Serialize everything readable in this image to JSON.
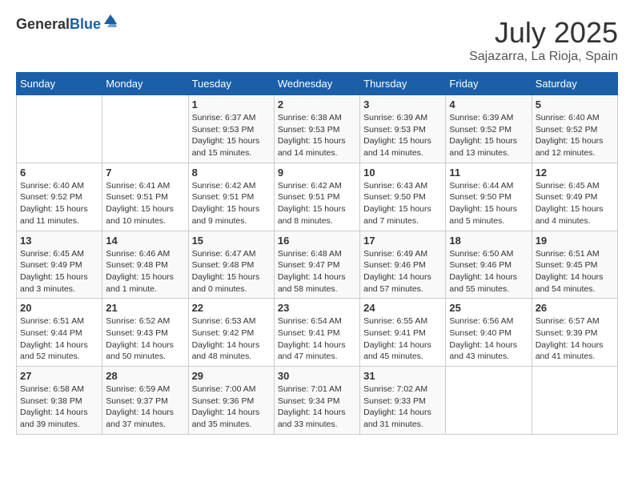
{
  "header": {
    "logo_general": "General",
    "logo_blue": "Blue",
    "month_year": "July 2025",
    "location": "Sajazarra, La Rioja, Spain"
  },
  "columns": [
    "Sunday",
    "Monday",
    "Tuesday",
    "Wednesday",
    "Thursday",
    "Friday",
    "Saturday"
  ],
  "weeks": [
    [
      {
        "day": "",
        "sunrise": "",
        "sunset": "",
        "daylight": ""
      },
      {
        "day": "",
        "sunrise": "",
        "sunset": "",
        "daylight": ""
      },
      {
        "day": "1",
        "sunrise": "Sunrise: 6:37 AM",
        "sunset": "Sunset: 9:53 PM",
        "daylight": "Daylight: 15 hours and 15 minutes."
      },
      {
        "day": "2",
        "sunrise": "Sunrise: 6:38 AM",
        "sunset": "Sunset: 9:53 PM",
        "daylight": "Daylight: 15 hours and 14 minutes."
      },
      {
        "day": "3",
        "sunrise": "Sunrise: 6:39 AM",
        "sunset": "Sunset: 9:53 PM",
        "daylight": "Daylight: 15 hours and 14 minutes."
      },
      {
        "day": "4",
        "sunrise": "Sunrise: 6:39 AM",
        "sunset": "Sunset: 9:52 PM",
        "daylight": "Daylight: 15 hours and 13 minutes."
      },
      {
        "day": "5",
        "sunrise": "Sunrise: 6:40 AM",
        "sunset": "Sunset: 9:52 PM",
        "daylight": "Daylight: 15 hours and 12 minutes."
      }
    ],
    [
      {
        "day": "6",
        "sunrise": "Sunrise: 6:40 AM",
        "sunset": "Sunset: 9:52 PM",
        "daylight": "Daylight: 15 hours and 11 minutes."
      },
      {
        "day": "7",
        "sunrise": "Sunrise: 6:41 AM",
        "sunset": "Sunset: 9:51 PM",
        "daylight": "Daylight: 15 hours and 10 minutes."
      },
      {
        "day": "8",
        "sunrise": "Sunrise: 6:42 AM",
        "sunset": "Sunset: 9:51 PM",
        "daylight": "Daylight: 15 hours and 9 minutes."
      },
      {
        "day": "9",
        "sunrise": "Sunrise: 6:42 AM",
        "sunset": "Sunset: 9:51 PM",
        "daylight": "Daylight: 15 hours and 8 minutes."
      },
      {
        "day": "10",
        "sunrise": "Sunrise: 6:43 AM",
        "sunset": "Sunset: 9:50 PM",
        "daylight": "Daylight: 15 hours and 7 minutes."
      },
      {
        "day": "11",
        "sunrise": "Sunrise: 6:44 AM",
        "sunset": "Sunset: 9:50 PM",
        "daylight": "Daylight: 15 hours and 5 minutes."
      },
      {
        "day": "12",
        "sunrise": "Sunrise: 6:45 AM",
        "sunset": "Sunset: 9:49 PM",
        "daylight": "Daylight: 15 hours and 4 minutes."
      }
    ],
    [
      {
        "day": "13",
        "sunrise": "Sunrise: 6:45 AM",
        "sunset": "Sunset: 9:49 PM",
        "daylight": "Daylight: 15 hours and 3 minutes."
      },
      {
        "day": "14",
        "sunrise": "Sunrise: 6:46 AM",
        "sunset": "Sunset: 9:48 PM",
        "daylight": "Daylight: 15 hours and 1 minute."
      },
      {
        "day": "15",
        "sunrise": "Sunrise: 6:47 AM",
        "sunset": "Sunset: 9:48 PM",
        "daylight": "Daylight: 15 hours and 0 minutes."
      },
      {
        "day": "16",
        "sunrise": "Sunrise: 6:48 AM",
        "sunset": "Sunset: 9:47 PM",
        "daylight": "Daylight: 14 hours and 58 minutes."
      },
      {
        "day": "17",
        "sunrise": "Sunrise: 6:49 AM",
        "sunset": "Sunset: 9:46 PM",
        "daylight": "Daylight: 14 hours and 57 minutes."
      },
      {
        "day": "18",
        "sunrise": "Sunrise: 6:50 AM",
        "sunset": "Sunset: 9:46 PM",
        "daylight": "Daylight: 14 hours and 55 minutes."
      },
      {
        "day": "19",
        "sunrise": "Sunrise: 6:51 AM",
        "sunset": "Sunset: 9:45 PM",
        "daylight": "Daylight: 14 hours and 54 minutes."
      }
    ],
    [
      {
        "day": "20",
        "sunrise": "Sunrise: 6:51 AM",
        "sunset": "Sunset: 9:44 PM",
        "daylight": "Daylight: 14 hours and 52 minutes."
      },
      {
        "day": "21",
        "sunrise": "Sunrise: 6:52 AM",
        "sunset": "Sunset: 9:43 PM",
        "daylight": "Daylight: 14 hours and 50 minutes."
      },
      {
        "day": "22",
        "sunrise": "Sunrise: 6:53 AM",
        "sunset": "Sunset: 9:42 PM",
        "daylight": "Daylight: 14 hours and 48 minutes."
      },
      {
        "day": "23",
        "sunrise": "Sunrise: 6:54 AM",
        "sunset": "Sunset: 9:41 PM",
        "daylight": "Daylight: 14 hours and 47 minutes."
      },
      {
        "day": "24",
        "sunrise": "Sunrise: 6:55 AM",
        "sunset": "Sunset: 9:41 PM",
        "daylight": "Daylight: 14 hours and 45 minutes."
      },
      {
        "day": "25",
        "sunrise": "Sunrise: 6:56 AM",
        "sunset": "Sunset: 9:40 PM",
        "daylight": "Daylight: 14 hours and 43 minutes."
      },
      {
        "day": "26",
        "sunrise": "Sunrise: 6:57 AM",
        "sunset": "Sunset: 9:39 PM",
        "daylight": "Daylight: 14 hours and 41 minutes."
      }
    ],
    [
      {
        "day": "27",
        "sunrise": "Sunrise: 6:58 AM",
        "sunset": "Sunset: 9:38 PM",
        "daylight": "Daylight: 14 hours and 39 minutes."
      },
      {
        "day": "28",
        "sunrise": "Sunrise: 6:59 AM",
        "sunset": "Sunset: 9:37 PM",
        "daylight": "Daylight: 14 hours and 37 minutes."
      },
      {
        "day": "29",
        "sunrise": "Sunrise: 7:00 AM",
        "sunset": "Sunset: 9:36 PM",
        "daylight": "Daylight: 14 hours and 35 minutes."
      },
      {
        "day": "30",
        "sunrise": "Sunrise: 7:01 AM",
        "sunset": "Sunset: 9:34 PM",
        "daylight": "Daylight: 14 hours and 33 minutes."
      },
      {
        "day": "31",
        "sunrise": "Sunrise: 7:02 AM",
        "sunset": "Sunset: 9:33 PM",
        "daylight": "Daylight: 14 hours and 31 minutes."
      },
      {
        "day": "",
        "sunrise": "",
        "sunset": "",
        "daylight": ""
      },
      {
        "day": "",
        "sunrise": "",
        "sunset": "",
        "daylight": ""
      }
    ]
  ]
}
